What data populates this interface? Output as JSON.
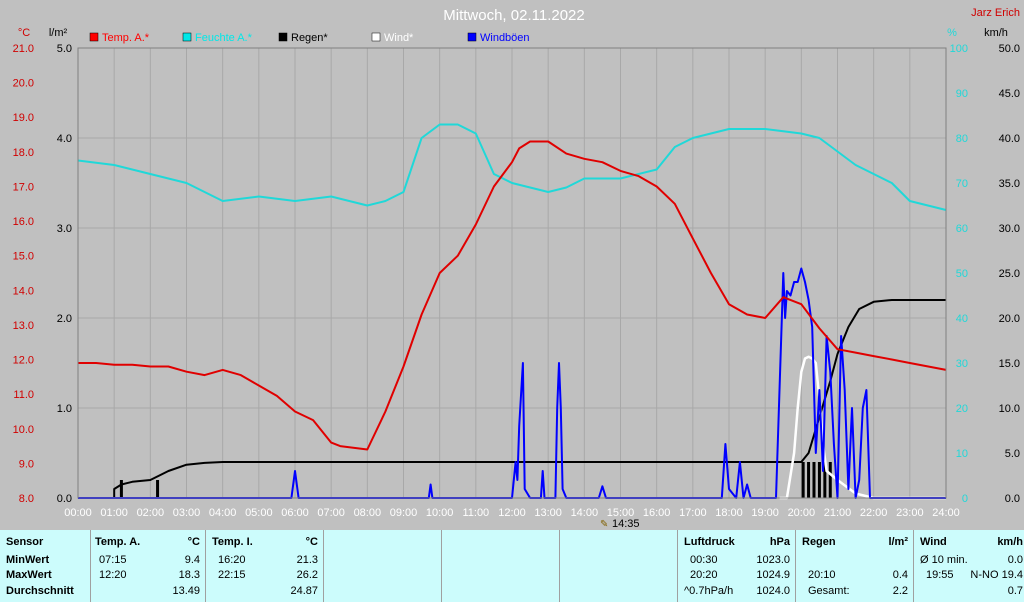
{
  "title": "Mittwoch, 02.11.2022",
  "author": "Jarz Erich",
  "axes": {
    "temp_unit": "°C",
    "rain_unit": "l/m²",
    "hum_unit": "%",
    "wind_unit": "km/h",
    "temp_ticks": [
      "21.0",
      "20.0",
      "19.0",
      "18.0",
      "17.0",
      "16.0",
      "15.0",
      "14.0",
      "13.0",
      "12.0",
      "11.0",
      "10.0",
      "9.0",
      "8.0"
    ],
    "rain_ticks": [
      "5.0",
      "4.0",
      "3.0",
      "2.0",
      "1.0",
      "0.0"
    ],
    "hum_ticks": [
      "100",
      "90",
      "80",
      "70",
      "60",
      "50",
      "40",
      "30",
      "20",
      "10",
      "0"
    ],
    "wind_ticks": [
      "50.0",
      "45.0",
      "40.0",
      "35.0",
      "30.0",
      "25.0",
      "20.0",
      "15.0",
      "10.0",
      "5.0",
      "0.0"
    ],
    "time_ticks": [
      "00:00",
      "01:00",
      "02:00",
      "03:00",
      "04:00",
      "05:00",
      "06:00",
      "07:00",
      "08:00",
      "09:00",
      "10:00",
      "11:00",
      "12:00",
      "13:00",
      "14:00",
      "15:00",
      "16:00",
      "17:00",
      "18:00",
      "19:00",
      "20:00",
      "21:00",
      "22:00",
      "23:00",
      "24:00"
    ],
    "marker_label": "14:35"
  },
  "legend": [
    {
      "label": "Temp. A.*",
      "color": "#ff0000"
    },
    {
      "label": "Feuchte A.*",
      "color": "#00e8e8"
    },
    {
      "label": "Regen*",
      "color": "#000000"
    },
    {
      "label": "Wind*",
      "color": "#ffffff"
    },
    {
      "label": "Windböen",
      "color": "#0000ff"
    }
  ],
  "colors": {
    "temp": "#e00000",
    "hum": "#20d8d8",
    "rain": "#000000",
    "wind": "#ffffff",
    "gust": "#0000ff",
    "grid": "#a8a8a8"
  },
  "chart_data": {
    "type": "line",
    "x_unit": "hours",
    "xlim": [
      0,
      24
    ],
    "temp": {
      "ylim": [
        8,
        21
      ],
      "points": [
        [
          0,
          11.9
        ],
        [
          0.5,
          11.9
        ],
        [
          1,
          11.85
        ],
        [
          1.5,
          11.85
        ],
        [
          2,
          11.8
        ],
        [
          2.5,
          11.8
        ],
        [
          3,
          11.65
        ],
        [
          3.5,
          11.55
        ],
        [
          4,
          11.7
        ],
        [
          4.5,
          11.55
        ],
        [
          5,
          11.25
        ],
        [
          5.5,
          10.95
        ],
        [
          6,
          10.5
        ],
        [
          6.5,
          10.25
        ],
        [
          7,
          9.6
        ],
        [
          7.25,
          9.5
        ],
        [
          8,
          9.4
        ],
        [
          8.5,
          10.5
        ],
        [
          9,
          11.8
        ],
        [
          9.5,
          13.3
        ],
        [
          10,
          14.5
        ],
        [
          10.5,
          15.0
        ],
        [
          11,
          15.9
        ],
        [
          11.5,
          17.0
        ],
        [
          12,
          17.7
        ],
        [
          12.2,
          18.1
        ],
        [
          12.5,
          18.3
        ],
        [
          13,
          18.3
        ],
        [
          13.5,
          17.95
        ],
        [
          14,
          17.8
        ],
        [
          14.5,
          17.7
        ],
        [
          15,
          17.45
        ],
        [
          15.5,
          17.3
        ],
        [
          16,
          17.0
        ],
        [
          16.5,
          16.5
        ],
        [
          17,
          15.5
        ],
        [
          17.5,
          14.5
        ],
        [
          18,
          13.6
        ],
        [
          18.5,
          13.3
        ],
        [
          19,
          13.2
        ],
        [
          19.5,
          13.8
        ],
        [
          20,
          13.6
        ],
        [
          20.5,
          12.9
        ],
        [
          21,
          12.3
        ],
        [
          21.5,
          12.2
        ],
        [
          22,
          12.1
        ],
        [
          22.5,
          12.0
        ],
        [
          23,
          11.9
        ],
        [
          24,
          11.7
        ]
      ]
    },
    "humidity": {
      "ylim": [
        0,
        100
      ],
      "points": [
        [
          0,
          75
        ],
        [
          1,
          74
        ],
        [
          2,
          72
        ],
        [
          3,
          70
        ],
        [
          4,
          66
        ],
        [
          5,
          67
        ],
        [
          6,
          66
        ],
        [
          7,
          67
        ],
        [
          8,
          65
        ],
        [
          8.5,
          66
        ],
        [
          9,
          68
        ],
        [
          9.5,
          80
        ],
        [
          10,
          83
        ],
        [
          10.5,
          83
        ],
        [
          11,
          81
        ],
        [
          11.5,
          72
        ],
        [
          12,
          70
        ],
        [
          12.5,
          69
        ],
        [
          13,
          68
        ],
        [
          13.5,
          69
        ],
        [
          14,
          71
        ],
        [
          15,
          71
        ],
        [
          16,
          73
        ],
        [
          16.5,
          78
        ],
        [
          17,
          80
        ],
        [
          18,
          82
        ],
        [
          19,
          82
        ],
        [
          20,
          81
        ],
        [
          20.5,
          80
        ],
        [
          21,
          77
        ],
        [
          21.5,
          74
        ],
        [
          22,
          72
        ],
        [
          22.5,
          70
        ],
        [
          23,
          66
        ],
        [
          24,
          64
        ]
      ]
    },
    "rain": {
      "ylim": [
        0,
        5
      ],
      "points": [
        [
          0,
          0
        ],
        [
          1,
          0
        ],
        [
          1,
          0.1
        ],
        [
          1.2,
          0.15
        ],
        [
          1.5,
          0.18
        ],
        [
          2,
          0.2
        ],
        [
          2.25,
          0.25
        ],
        [
          2.5,
          0.3
        ],
        [
          3,
          0.37
        ],
        [
          3.5,
          0.39
        ],
        [
          4,
          0.4
        ],
        [
          6,
          0.4
        ],
        [
          8,
          0.4
        ],
        [
          10,
          0.4
        ],
        [
          12,
          0.4
        ],
        [
          14,
          0.4
        ],
        [
          16,
          0.4
        ],
        [
          18,
          0.4
        ],
        [
          19.5,
          0.4
        ],
        [
          20,
          0.4
        ],
        [
          20.2,
          0.5
        ],
        [
          20.5,
          0.9
        ],
        [
          20.8,
          1.3
        ],
        [
          21,
          1.6
        ],
        [
          21.3,
          1.9
        ],
        [
          21.6,
          2.1
        ],
        [
          22,
          2.18
        ],
        [
          22.5,
          2.2
        ],
        [
          24,
          2.2
        ]
      ]
    },
    "rain_bars": {
      "ylim": [
        0,
        5
      ],
      "points": [
        [
          1.2,
          0.2
        ],
        [
          2.2,
          0.2
        ],
        [
          20.05,
          0.4
        ],
        [
          20.2,
          0.4
        ],
        [
          20.35,
          0.4
        ],
        [
          20.5,
          0.4
        ],
        [
          20.65,
          0.4
        ],
        [
          20.8,
          0.4
        ]
      ]
    },
    "wind": {
      "ylim": [
        0,
        50
      ],
      "points": [
        [
          19.4,
          0
        ],
        [
          19.6,
          0
        ],
        [
          19.8,
          5
        ],
        [
          19.9,
          10
        ],
        [
          20,
          14
        ],
        [
          20.1,
          15.5
        ],
        [
          20.2,
          15.7
        ],
        [
          20.3,
          15.5
        ],
        [
          20.4,
          15
        ],
        [
          20.5,
          11
        ],
        [
          20.6,
          6
        ],
        [
          20.7,
          3
        ],
        [
          21,
          2
        ],
        [
          21.5,
          0.5
        ],
        [
          22,
          0
        ],
        [
          24,
          0
        ]
      ]
    },
    "gust": {
      "ylim": [
        0,
        50
      ],
      "points": [
        [
          0,
          0
        ],
        [
          5.9,
          0
        ],
        [
          6,
          3
        ],
        [
          6.1,
          0
        ],
        [
          9.7,
          0
        ],
        [
          9.75,
          1.5
        ],
        [
          9.8,
          0
        ],
        [
          12,
          0
        ],
        [
          12.1,
          4
        ],
        [
          12.15,
          2
        ],
        [
          12.2,
          8
        ],
        [
          12.3,
          15
        ],
        [
          12.35,
          1
        ],
        [
          12.5,
          0
        ],
        [
          12.8,
          0
        ],
        [
          12.85,
          3
        ],
        [
          12.9,
          0
        ],
        [
          13.2,
          0
        ],
        [
          13.25,
          10
        ],
        [
          13.3,
          15
        ],
        [
          13.35,
          10
        ],
        [
          13.4,
          1
        ],
        [
          13.5,
          0
        ],
        [
          14.4,
          0
        ],
        [
          14.5,
          1.3
        ],
        [
          14.6,
          0
        ],
        [
          17.8,
          0
        ],
        [
          17.9,
          6
        ],
        [
          18.0,
          1
        ],
        [
          18.2,
          0
        ],
        [
          18.3,
          4
        ],
        [
          18.4,
          0
        ],
        [
          18.5,
          1.5
        ],
        [
          18.6,
          0
        ],
        [
          19.3,
          0
        ],
        [
          19.5,
          25
        ],
        [
          19.55,
          20
        ],
        [
          19.6,
          23
        ],
        [
          19.7,
          22.5
        ],
        [
          19.8,
          24
        ],
        [
          19.9,
          24
        ],
        [
          20.0,
          25.5
        ],
        [
          20.1,
          24
        ],
        [
          20.2,
          22
        ],
        [
          20.3,
          19
        ],
        [
          20.4,
          5
        ],
        [
          20.5,
          12
        ],
        [
          20.6,
          3
        ],
        [
          20.7,
          18
        ],
        [
          20.8,
          14
        ],
        [
          20.9,
          6
        ],
        [
          21.0,
          0
        ],
        [
          21.1,
          18
        ],
        [
          21.2,
          12
        ],
        [
          21.3,
          1
        ],
        [
          21.4,
          10
        ],
        [
          21.5,
          0
        ],
        [
          21.6,
          2
        ],
        [
          21.7,
          10
        ],
        [
          21.8,
          12
        ],
        [
          21.9,
          0
        ],
        [
          22,
          0
        ],
        [
          24,
          0
        ]
      ]
    }
  },
  "table": {
    "sensor": {
      "header": "Sensor",
      "rows": [
        "MinWert",
        "MaxWert",
        "Durchschnitt"
      ]
    },
    "temp_a": {
      "header": "Temp. A.",
      "unit": "°C",
      "times": [
        "07:15",
        "12:20",
        ""
      ],
      "values": [
        "9.4",
        "18.3",
        "13.49"
      ]
    },
    "temp_i": {
      "header": "Temp. I.",
      "unit": "°C",
      "times": [
        "16:20",
        "22:15",
        ""
      ],
      "values": [
        "21.3",
        "26.2",
        "24.87"
      ]
    },
    "pressure": {
      "header": "Luftdruck",
      "unit": "hPa",
      "times": [
        "00:30",
        "20:20",
        "^0.7hPa/h"
      ],
      "values": [
        "1023.0",
        "1024.9",
        "1024.0"
      ]
    },
    "rain": {
      "header": "Regen",
      "unit": "l/m²",
      "times": [
        "",
        "20:10",
        "Gesamt:"
      ],
      "values": [
        "",
        "0.4",
        "2.2"
      ]
    },
    "wind": {
      "header": "Wind",
      "unit": "km/h",
      "times": [
        "Ø 10 min.",
        "19:55",
        "N-NO 19.4"
      ],
      "values": [
        "0.0",
        "",
        ""
      ],
      "extra": [
        "",
        "",
        "0.7"
      ]
    }
  }
}
